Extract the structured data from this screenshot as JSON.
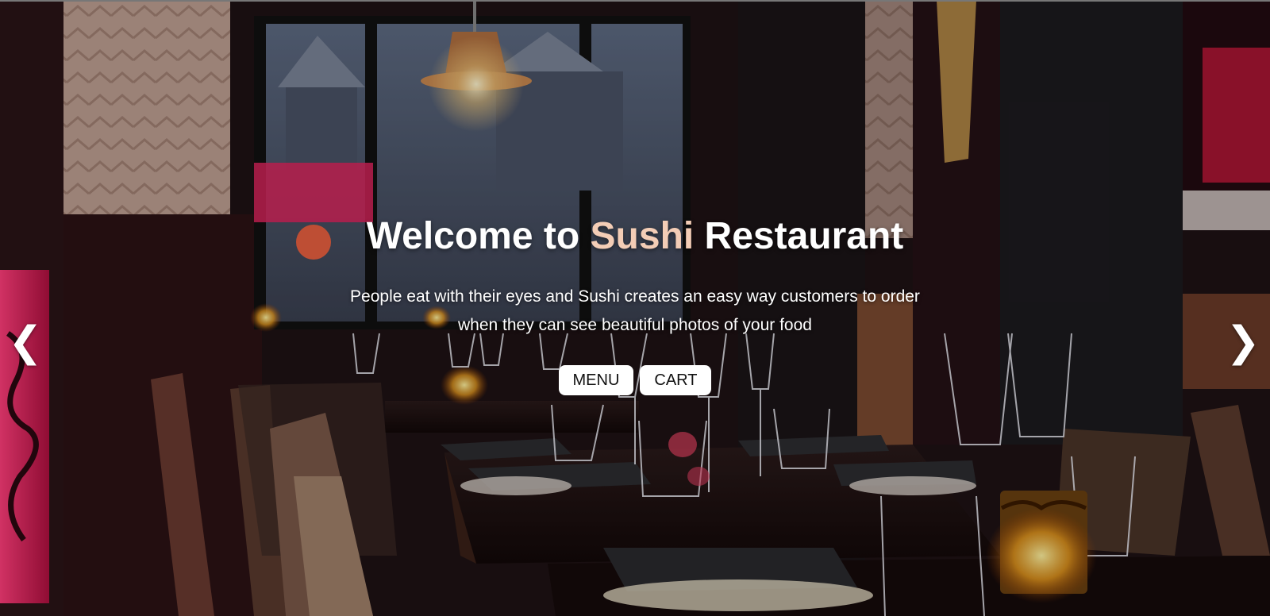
{
  "hero": {
    "title_prefix": "Welcome to ",
    "title_brand": "Sushi",
    "title_suffix": " Restaurant",
    "tagline": "People eat with their eyes and Sushi creates an easy way customers to order when they can see beautiful photos of your food",
    "buttons": {
      "menu": "MENU",
      "cart": "CART"
    },
    "brand_color": "#f3cdb6"
  },
  "carousel": {
    "prev_icon": "chevron-left-icon",
    "next_icon": "chevron-right-icon",
    "prev_glyph": "❮",
    "next_glyph": "❯"
  }
}
